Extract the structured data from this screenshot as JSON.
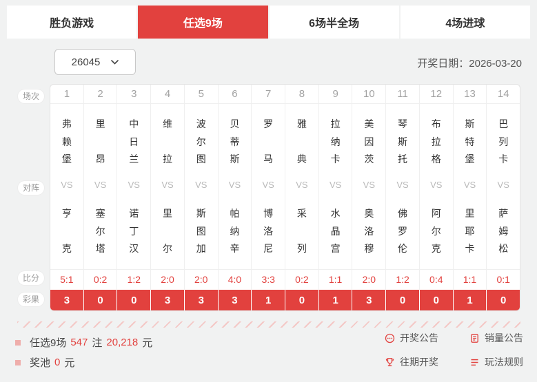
{
  "tabs": [
    {
      "label": "胜负游戏",
      "active": false
    },
    {
      "label": "任选9场",
      "active": true
    },
    {
      "label": "6场半全场",
      "active": false
    },
    {
      "label": "4场进球",
      "active": false
    }
  ],
  "controls": {
    "period": "26045",
    "draw_date_label": "开奖日期：",
    "draw_date": "2026-03-20"
  },
  "table": {
    "row_labels": {
      "session": "场次",
      "matchup": "对阵",
      "score": "比分",
      "result": "彩果"
    },
    "vs_label": "VS",
    "matches": [
      {
        "no": "1",
        "home": "弗赖堡",
        "away": "亨克",
        "score": "5:1",
        "result": "3"
      },
      {
        "no": "2",
        "home": "里昂",
        "away": "塞尔塔",
        "score": "0:2",
        "result": "0"
      },
      {
        "no": "3",
        "home": "中日兰",
        "away": "诺丁汉",
        "score": "1:2",
        "result": "0"
      },
      {
        "no": "4",
        "home": "维拉",
        "away": "里尔",
        "score": "2:0",
        "result": "3"
      },
      {
        "no": "5",
        "home": "波尔图",
        "away": "斯图加",
        "score": "2:0",
        "result": "3"
      },
      {
        "no": "6",
        "home": "贝蒂斯",
        "away": "帕纳辛",
        "score": "4:0",
        "result": "3"
      },
      {
        "no": "7",
        "home": "罗马",
        "away": "博洛尼",
        "score": "3:3",
        "result": "1"
      },
      {
        "no": "8",
        "home": "雅典",
        "away": "采列",
        "score": "0:2",
        "result": "0"
      },
      {
        "no": "9",
        "home": "拉纳卡",
        "away": "水晶宫",
        "score": "1:1",
        "result": "1"
      },
      {
        "no": "10",
        "home": "美因茨",
        "away": "奥洛穆",
        "score": "2:0",
        "result": "3"
      },
      {
        "no": "11",
        "home": "琴斯托",
        "away": "佛罗伦",
        "score": "1:2",
        "result": "0"
      },
      {
        "no": "12",
        "home": "布拉格",
        "away": "阿尔克",
        "score": "0:4",
        "result": "0"
      },
      {
        "no": "13",
        "home": "斯特堡",
        "away": "里耶卡",
        "score": "1:1",
        "result": "1"
      },
      {
        "no": "14",
        "home": "巴列卡",
        "away": "萨姆松",
        "score": "0:1",
        "result": "0"
      }
    ]
  },
  "summary": {
    "line1": {
      "label": "任选9场",
      "bets": "547",
      "bets_unit": "注",
      "amount": "20,218",
      "amount_unit": "元"
    },
    "line2": {
      "label": "奖池",
      "amount": "0",
      "amount_unit": "元"
    }
  },
  "links": [
    {
      "label": "开奖公告",
      "icon": "announcement-icon"
    },
    {
      "label": "销量公告",
      "icon": "sales-icon"
    },
    {
      "label": "往期开奖",
      "icon": "trophy-icon"
    },
    {
      "label": "玩法规则",
      "icon": "rules-icon"
    }
  ],
  "colors": {
    "accent": "#e2413e",
    "page_bg": "#f1f2f2",
    "bullet_pink": "#efaeab",
    "stripe_pink": "#f4c8c6"
  }
}
